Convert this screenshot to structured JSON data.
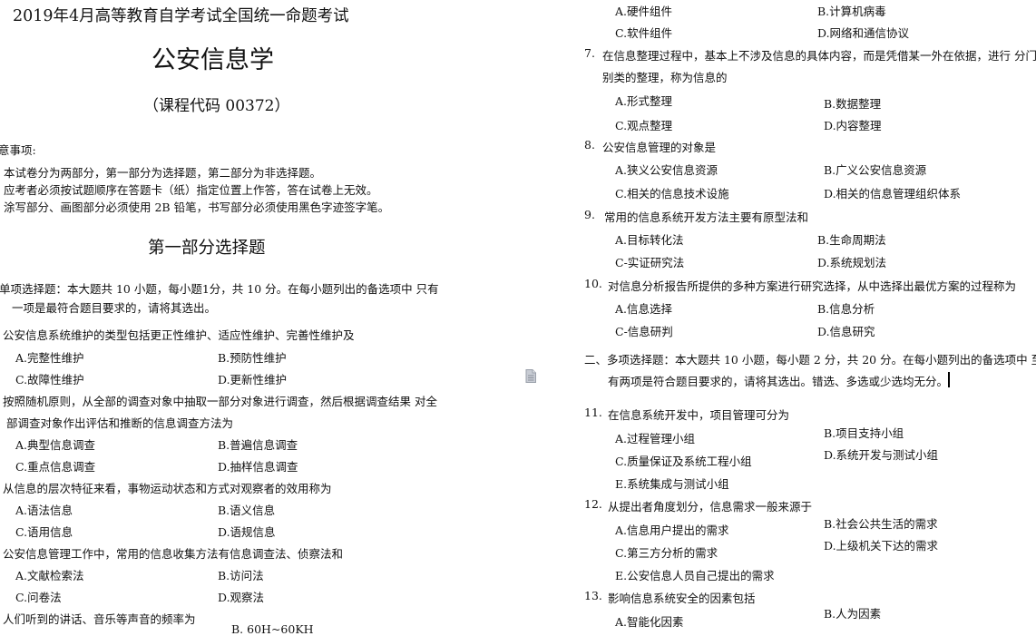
{
  "header": {
    "exam_title": "2019年4月高等教育自学考试全国统一命题考试",
    "subject": "公安信息学",
    "course_code": "（课程代码 00372）"
  },
  "notes": {
    "title": "意事项:",
    "items": [
      "本试卷分为两部分，第一部分为选择题，第二部分为非选择题。",
      "应考者必须按试题顺序在答题卡（纸）指定位置上作答，答在试卷上无效。",
      "涂写部分、画图部分必须使用 2B 铅笔，书写部分必须使用黑色字迹签字笔。"
    ]
  },
  "part1": {
    "title": "第一部分选择题",
    "section1": {
      "line1": "单项选择题：本大题共 10 小题，每小题1分，共 10 分。在每小题列出的备选项中 只有",
      "line2": "一项是最符合题目要求的，请将其选出。"
    }
  },
  "left_questions": [
    {
      "stem": [
        "公安信息系统维护的类型包括更正性维护、适应性维护、完善性维护及"
      ],
      "options": [
        "A.完整性维护",
        "B.预防性维护",
        "C.故障性维护",
        "D.更新性维护"
      ]
    },
    {
      "stem": [
        "按照随机原则，从全部的调查对象中抽取一部分对象进行调查，然后根据调查结果 对全",
        "部调查对象作出评估和推断的信息调查方法为"
      ],
      "options": [
        "A.典型信息调查",
        "B.普遍信息调查",
        "C.重点信息调查",
        "D.抽样信息调查"
      ]
    },
    {
      "stem": [
        "从信息的层次特征来看，事物运动状态和方式对观察者的效用称为"
      ],
      "options": [
        "A.语法信息",
        "B.语义信息",
        "C.语用信息",
        "D.语规信息"
      ]
    },
    {
      "stem": [
        "公安信息管理工作中，常用的信息收集方法有信息调查法、侦察法和"
      ],
      "options": [
        "A.文献检索法",
        "B.访问法",
        "C.问卷法",
        "D.观察法"
      ]
    },
    {
      "stem": [
        "人们听到的讲话、音乐等声音的频率为"
      ],
      "options": [
        "B. 60H~60KH"
      ]
    }
  ],
  "right_top_options": [
    "A.硬件组件",
    "B.计算机病毒",
    "C.软件组件",
    "D.网络和通信协议"
  ],
  "right_questions": [
    {
      "number": "7.",
      "stem": [
        "在信息整理过程中，基本上不涉及信息的具体内容，而是凭借某一外在依据，进行 分门",
        "别类的整理，称为信息的"
      ],
      "options": [
        "A.形式整理",
        "B.数据整理",
        "C.观点整理",
        "D.内容整理"
      ]
    },
    {
      "number": "8.",
      "stem": [
        "公安信息管理的对象是"
      ],
      "options": [
        "A.狭义公安信息资源",
        "B.广义公安信息资源",
        "C.相关的信息技术设施",
        "D.相关的信息管理组织体系"
      ]
    },
    {
      "number": "9.",
      "stem": [
        "常用的信息系统开发方法主要有原型法和"
      ],
      "options": [
        "A.目标转化法",
        "B.生命周期法",
        "C-实证研究法",
        "D.系统规划法"
      ]
    },
    {
      "number": "10.",
      "stem": [
        "对信息分析报告所提供的多种方案进行研究选择，从中选择出最优方案的过程称为"
      ],
      "options": [
        "A.信息选择",
        "B.信息分析",
        "C-信息研判",
        "D.信息研究"
      ]
    }
  ],
  "section2": {
    "line1": "二、多项选择题：本大题共 10 小题，每小题 2 分，共 20 分。在每小题列出的备选项中 至少",
    "line2": "有两项是符合题目要求的，请将其选出。错选、多选或少选均无分。"
  },
  "multi_questions": [
    {
      "number": "11.",
      "stem": "在信息系统开发中，项目管理可分为",
      "options": [
        "A.过程管理小组",
        "B.项目支持小组",
        "C.质量保证及系统工程小组",
        "D.系统开发与测试小组",
        "E.系统集成与测试小组"
      ]
    },
    {
      "number": "12.",
      "stem": "从提出者角度划分，信息需求一般来源于",
      "options": [
        "A.信息用户提出的需求",
        "B.社会公共生活的需求",
        "C.第三方分析的需求",
        "D.上级机关下达的需求",
        "E.公安信息人员自己提出的需求"
      ]
    },
    {
      "number": "13.",
      "stem": "影响信息系统安全的因素包括",
      "options": [
        "A.智能化因素",
        "B.人为因素"
      ]
    }
  ]
}
